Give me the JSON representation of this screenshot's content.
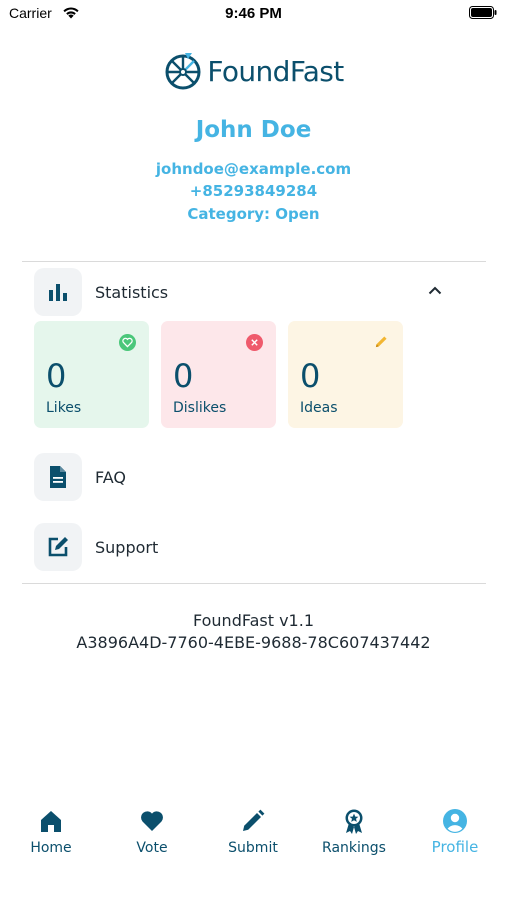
{
  "status_bar": {
    "carrier": "Carrier",
    "time": "9:46 PM"
  },
  "brand": {
    "name": "FoundFast",
    "primary_color": "#0b4f6c",
    "accent_color": "#45b4e3"
  },
  "profile": {
    "name": "John Doe",
    "email": "johndoe@example.com",
    "phone": "+85293849284",
    "category": "Category: Open"
  },
  "menu": {
    "statistics_label": "Statistics",
    "faq_label": "FAQ",
    "support_label": "Support"
  },
  "stats": [
    {
      "label": "Likes",
      "value": "0",
      "icon": "heart-icon",
      "color": "#4ac77a"
    },
    {
      "label": "Dislikes",
      "value": "0",
      "icon": "close-icon",
      "color": "#ef5a6c"
    },
    {
      "label": "Ideas",
      "value": "0",
      "icon": "pencil-icon",
      "color": "#f2b632"
    }
  ],
  "footer": {
    "version": "FoundFast v1.1",
    "device_id": "A3896A4D-7760-4EBE-9688-78C607437442"
  },
  "tabs": [
    {
      "label": "Home",
      "icon": "home-icon"
    },
    {
      "label": "Vote",
      "icon": "heart-icon"
    },
    {
      "label": "Submit",
      "icon": "pencil-icon"
    },
    {
      "label": "Rankings",
      "icon": "award-icon"
    },
    {
      "label": "Profile",
      "icon": "user-circle-icon",
      "active": true
    }
  ]
}
